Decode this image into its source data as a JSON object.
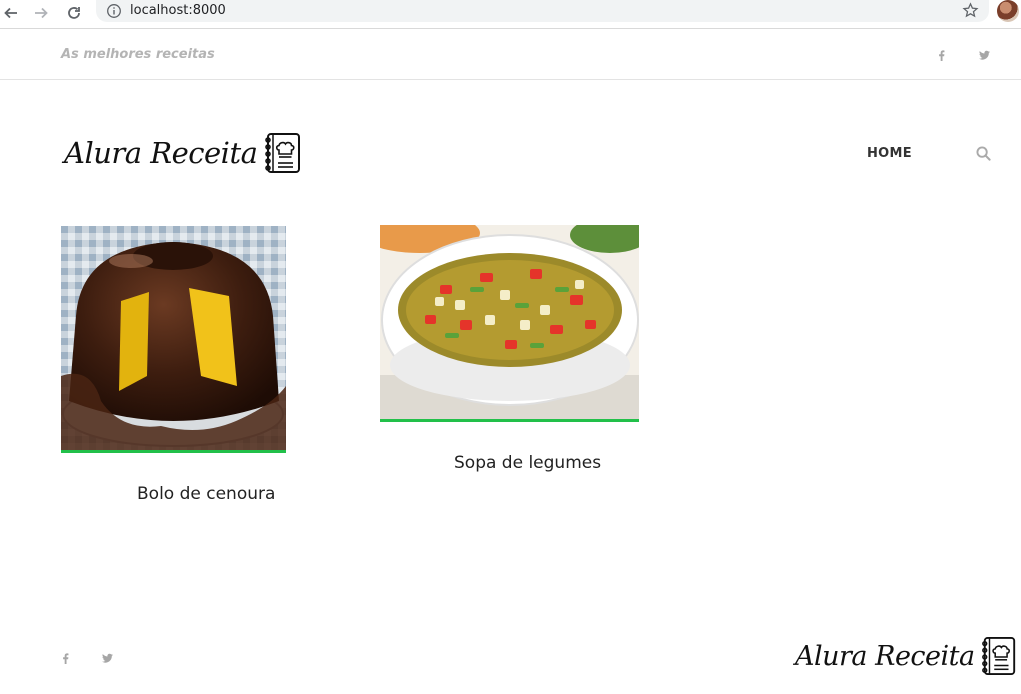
{
  "browser": {
    "url": "localhost:8000"
  },
  "topbar": {
    "tagline": "As melhores receitas",
    "social": [
      "facebook-icon",
      "twitter-icon"
    ]
  },
  "header": {
    "logo_text": "Alura Receita",
    "nav": [
      {
        "label": "HOME"
      }
    ],
    "search_icon": "search-icon"
  },
  "recipes": [
    {
      "title": "Bolo de cenoura",
      "image": "chocolate-carrot-cake-photo"
    },
    {
      "title": "Sopa de legumes",
      "image": "vegetable-soup-photo"
    }
  ],
  "footer": {
    "logo_text": "Alura Receita",
    "social": [
      "facebook-icon",
      "twitter-icon"
    ]
  },
  "colors": {
    "accent": "#22c04a",
    "tagline": "#b4b4b4",
    "icon_gray": "#a6a6a6"
  }
}
